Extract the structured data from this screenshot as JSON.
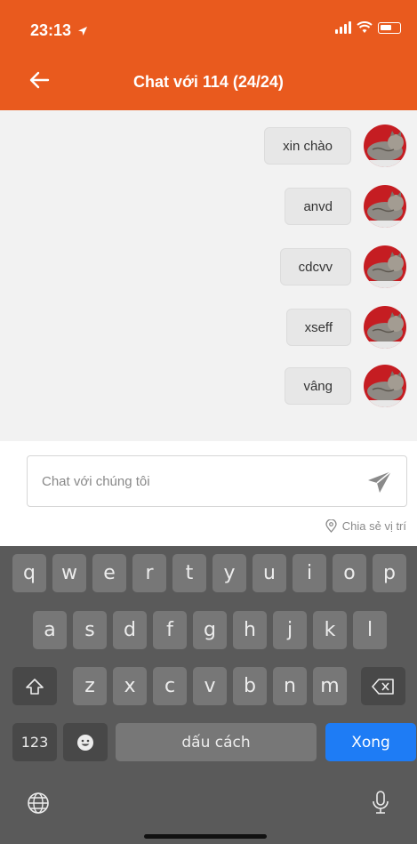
{
  "status_bar": {
    "time": "23:13"
  },
  "header": {
    "title": "Chat với 114 (24/24)"
  },
  "messages": [
    {
      "text": "xin chào"
    },
    {
      "text": "anvd"
    },
    {
      "text": "cdcvv"
    },
    {
      "text": "xseff"
    },
    {
      "text": "vâng"
    }
  ],
  "composer": {
    "placeholder": "Chat với chúng tôi",
    "value": ""
  },
  "share_location": {
    "label": "Chia sẻ vị trí"
  },
  "keyboard": {
    "row1": [
      "q",
      "w",
      "e",
      "r",
      "t",
      "y",
      "u",
      "i",
      "o",
      "p"
    ],
    "row2": [
      "a",
      "s",
      "d",
      "f",
      "g",
      "h",
      "j",
      "k",
      "l"
    ],
    "row3": [
      "z",
      "x",
      "c",
      "v",
      "b",
      "n",
      "m"
    ],
    "numbers_key": "123",
    "space_key": "dấu cách",
    "done_key": "Xong"
  },
  "colors": {
    "header": "#e95a1e",
    "done_key": "#1e7cf5",
    "keyboard": "#5a5a5a"
  }
}
